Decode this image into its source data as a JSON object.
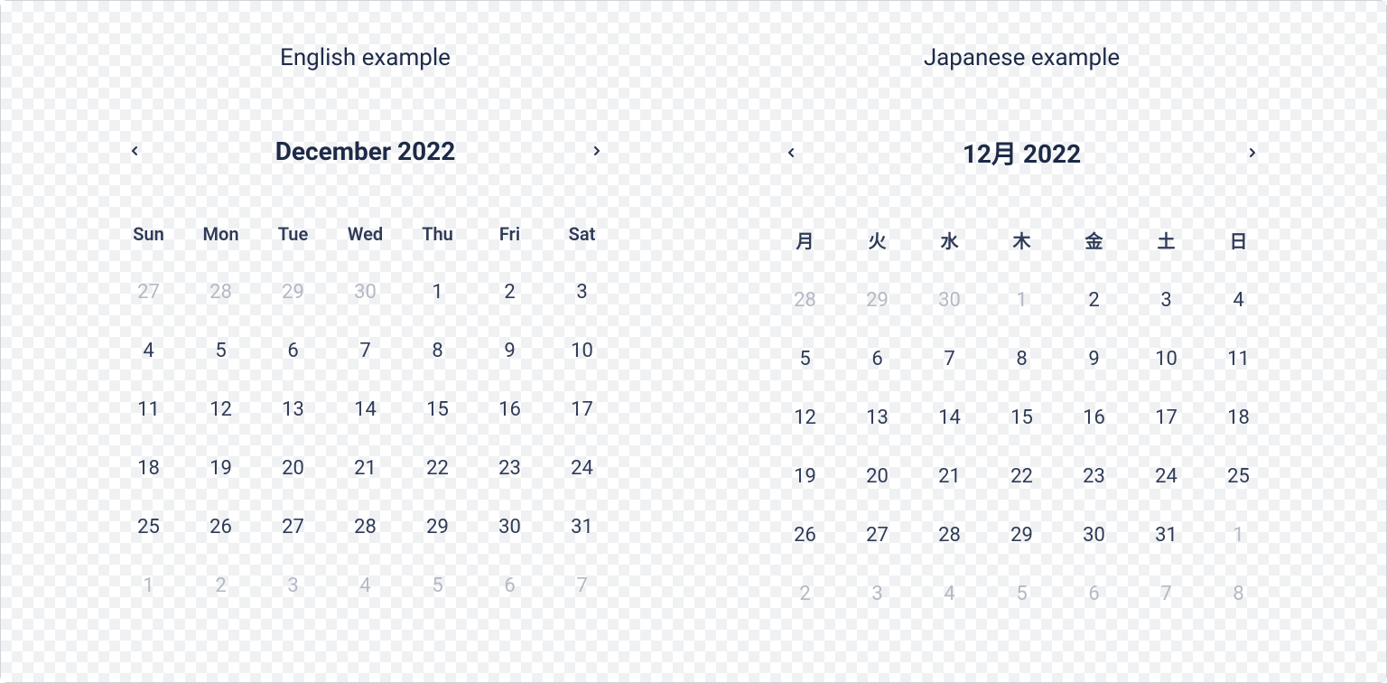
{
  "calendars": [
    {
      "example_label": "English example",
      "title": "December 2022",
      "weekdays": [
        "Sun",
        "Mon",
        "Tue",
        "Wed",
        "Thu",
        "Fri",
        "Sat"
      ],
      "days": [
        {
          "n": 27,
          "muted": true
        },
        {
          "n": 28,
          "muted": true
        },
        {
          "n": 29,
          "muted": true
        },
        {
          "n": 30,
          "muted": true
        },
        {
          "n": 1,
          "muted": false
        },
        {
          "n": 2,
          "muted": false
        },
        {
          "n": 3,
          "muted": false
        },
        {
          "n": 4,
          "muted": false
        },
        {
          "n": 5,
          "muted": false
        },
        {
          "n": 6,
          "muted": false
        },
        {
          "n": 7,
          "muted": false
        },
        {
          "n": 8,
          "muted": false
        },
        {
          "n": 9,
          "muted": false
        },
        {
          "n": 10,
          "muted": false
        },
        {
          "n": 11,
          "muted": false
        },
        {
          "n": 12,
          "muted": false
        },
        {
          "n": 13,
          "muted": false
        },
        {
          "n": 14,
          "muted": false
        },
        {
          "n": 15,
          "muted": false
        },
        {
          "n": 16,
          "muted": false
        },
        {
          "n": 17,
          "muted": false
        },
        {
          "n": 18,
          "muted": false
        },
        {
          "n": 19,
          "muted": false
        },
        {
          "n": 20,
          "muted": false
        },
        {
          "n": 21,
          "muted": false
        },
        {
          "n": 22,
          "muted": false
        },
        {
          "n": 23,
          "muted": false
        },
        {
          "n": 24,
          "muted": false
        },
        {
          "n": 25,
          "muted": false
        },
        {
          "n": 26,
          "muted": false
        },
        {
          "n": 27,
          "muted": false
        },
        {
          "n": 28,
          "muted": false
        },
        {
          "n": 29,
          "muted": false
        },
        {
          "n": 30,
          "muted": false
        },
        {
          "n": 31,
          "muted": false
        },
        {
          "n": 1,
          "muted": true
        },
        {
          "n": 2,
          "muted": true
        },
        {
          "n": 3,
          "muted": true
        },
        {
          "n": 4,
          "muted": true
        },
        {
          "n": 5,
          "muted": true
        },
        {
          "n": 6,
          "muted": true
        },
        {
          "n": 7,
          "muted": true
        }
      ]
    },
    {
      "example_label": "Japanese example",
      "title": "12月 2022",
      "weekdays": [
        "月",
        "火",
        "水",
        "木",
        "金",
        "土",
        "日"
      ],
      "days": [
        {
          "n": 28,
          "muted": true
        },
        {
          "n": 29,
          "muted": true
        },
        {
          "n": 30,
          "muted": true
        },
        {
          "n": 1,
          "muted": true
        },
        {
          "n": 2,
          "muted": false
        },
        {
          "n": 3,
          "muted": false
        },
        {
          "n": 4,
          "muted": false
        },
        {
          "n": 5,
          "muted": false
        },
        {
          "n": 6,
          "muted": false
        },
        {
          "n": 7,
          "muted": false
        },
        {
          "n": 8,
          "muted": false
        },
        {
          "n": 9,
          "muted": false
        },
        {
          "n": 10,
          "muted": false
        },
        {
          "n": 11,
          "muted": false
        },
        {
          "n": 12,
          "muted": false
        },
        {
          "n": 13,
          "muted": false
        },
        {
          "n": 14,
          "muted": false
        },
        {
          "n": 15,
          "muted": false
        },
        {
          "n": 16,
          "muted": false
        },
        {
          "n": 17,
          "muted": false
        },
        {
          "n": 18,
          "muted": false
        },
        {
          "n": 19,
          "muted": false
        },
        {
          "n": 20,
          "muted": false
        },
        {
          "n": 21,
          "muted": false
        },
        {
          "n": 22,
          "muted": false
        },
        {
          "n": 23,
          "muted": false
        },
        {
          "n": 24,
          "muted": false
        },
        {
          "n": 25,
          "muted": false
        },
        {
          "n": 26,
          "muted": false
        },
        {
          "n": 27,
          "muted": false
        },
        {
          "n": 28,
          "muted": false
        },
        {
          "n": 29,
          "muted": false
        },
        {
          "n": 30,
          "muted": false
        },
        {
          "n": 31,
          "muted": false
        },
        {
          "n": 1,
          "muted": true
        },
        {
          "n": 2,
          "muted": true
        },
        {
          "n": 3,
          "muted": true
        },
        {
          "n": 4,
          "muted": true
        },
        {
          "n": 5,
          "muted": true
        },
        {
          "n": 6,
          "muted": true
        },
        {
          "n": 7,
          "muted": true
        },
        {
          "n": 8,
          "muted": true
        }
      ]
    }
  ]
}
